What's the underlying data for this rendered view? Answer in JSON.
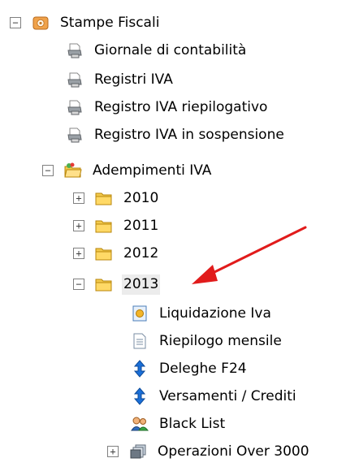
{
  "tree": {
    "stampe_fiscali": "Stampe Fiscali",
    "giornale": "Giornale di contabilità",
    "registri_iva": "Registri IVA",
    "registro_riepilogativo": "Registro IVA riepilogativo",
    "registro_sospensione": "Registro IVA in sospensione",
    "adempimenti": "Adempimenti IVA",
    "y2010": "2010",
    "y2011": "2011",
    "y2012": "2012",
    "y2013": "2013",
    "liquidazione": "Liquidazione Iva",
    "riepilogo": "Riepilogo mensile",
    "deleghe": "Deleghe F24",
    "versamenti": "Versamenti / Crediti",
    "black_list": "Black List",
    "operazioni": "Operazioni Over 3000"
  },
  "toggles": {
    "expanded": "−",
    "collapsed": "+"
  },
  "colors": {
    "arrow": "#e11b1b",
    "folder": "#f2c94c",
    "blue_arrow": "#1a6fd8"
  }
}
